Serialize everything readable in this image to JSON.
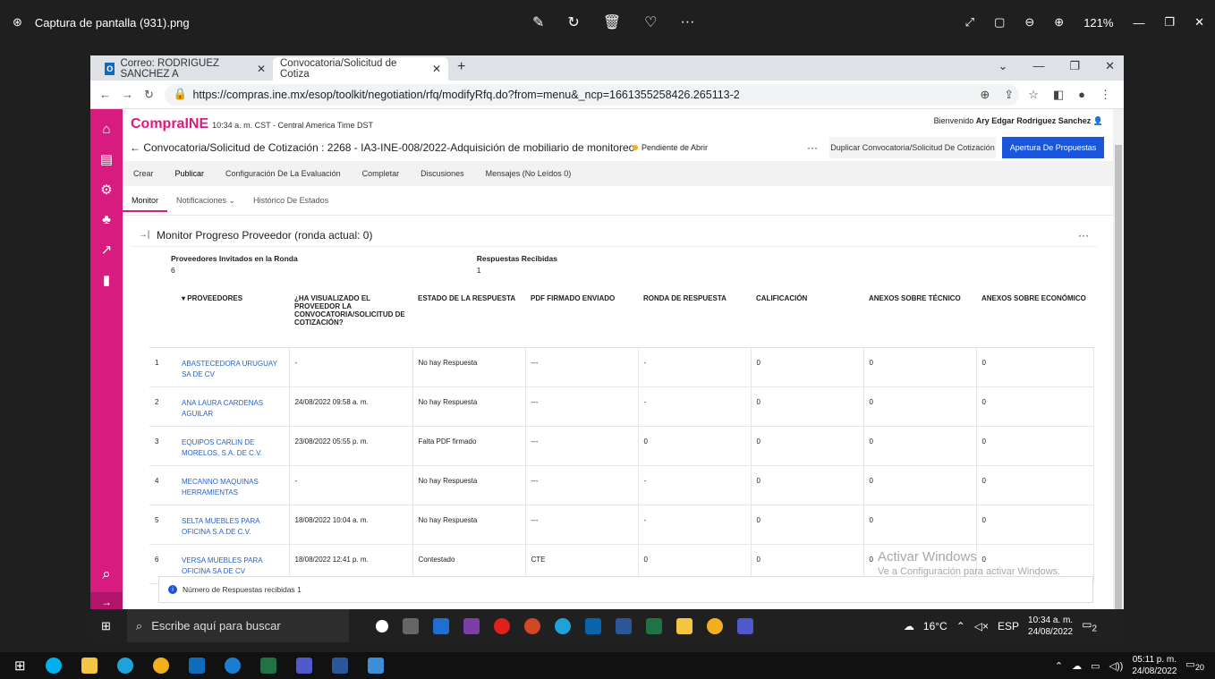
{
  "viewer": {
    "file": "Captura de pantalla (931).png",
    "zoom": "121%"
  },
  "browser": {
    "tabs": [
      {
        "label": "Correo: RODRIGUEZ SANCHEZ A"
      },
      {
        "label": "Convocatoria/Solicitud de Cotiza"
      }
    ],
    "url": "https://compras.ine.mx/esop/toolkit/negotiation/rfq/modifyRfq.do?from=menu&_ncp=1661355258426.265113-2"
  },
  "app": {
    "logo": "CompraINE",
    "time_zone": "10:34 a. m. CST - Central America Time DST",
    "welcome_prefix": "Bienvenido",
    "user": "Ary Edgar Rodriguez Sanchez",
    "page_title": "← Convocatoria/Solicitud de Cotización : 2268 - IA3-INE-008/2022-Adquisición de mobiliario de monitoreo",
    "status": "Pendiente de Abrir",
    "more": "···",
    "duplicate_label": "Duplicar Convocatoria/Solicitud De Cotización",
    "open_label": "Apertura De Propuestas",
    "menu": [
      "Crear",
      "Publicar",
      "Configuración De La Evaluación",
      "Completar",
      "Discusiones",
      "Mensajes (No Leídos 0)"
    ],
    "subtabs": [
      "Monitor",
      "Notificaciones ⌄",
      "Histórico De Estados"
    ],
    "panel_title": "Monitor Progreso Proveedor (ronda actual: 0)",
    "stats": [
      {
        "label": "Proveedores Invitados en la Ronda",
        "value": "6"
      },
      {
        "label": "Respuestas Recibidas",
        "value": "1"
      }
    ],
    "table": {
      "headers": [
        "",
        "▾ PROVEEDORES",
        "¿HA VISUALIZADO EL PROVEEDOR LA CONVOCATORIA/SOLICITUD DE COTIZACIÓN?",
        "ESTADO DE LA RESPUESTA",
        "PDF FIRMADO ENVIADO",
        "RONDA DE RESPUESTA",
        "CALIFICACIÓN",
        "ANEXOS SOBRE TÉCNICO",
        "ANEXOS SOBRE ECONÓMICO"
      ],
      "rows": [
        [
          "1",
          "ABASTECEDORA URUGUAY SA DE CV",
          "-",
          "No hay Respuesta",
          "---",
          "-",
          "0",
          "0",
          "0"
        ],
        [
          "2",
          "ANA LAURA CARDENAS AGUILAR",
          "24/08/2022 09:58 a. m.",
          "No hay Respuesta",
          "---",
          "-",
          "0",
          "0",
          "0"
        ],
        [
          "3",
          "EQUIPOS CARLIN DE MORELOS, S.A. DE C.V.",
          "23/08/2022 05:55 p. m.",
          "Falta PDF firmado",
          "---",
          "0",
          "0",
          "0",
          "0"
        ],
        [
          "4",
          "MECANNO MAQUINAS HERRAMIENTAS",
          "-",
          "No hay Respuesta",
          "---",
          "-",
          "0",
          "0",
          "0"
        ],
        [
          "5",
          "SELTA MUEBLES PARA OFICINA S.A.DE C.V.",
          "18/08/2022 10:04 a. m.",
          "No hay Respuesta",
          "---",
          "-",
          "0",
          "0",
          "0"
        ],
        [
          "6",
          "VERSA MUEBLES PARA OFICINA SA DE CV",
          "18/08/2022 12:41 p. m.",
          "Contestado",
          "CTE",
          "0",
          "0",
          "0",
          "0"
        ]
      ]
    },
    "footer_note": "Número de Respuestas recibidas 1"
  },
  "watermark": {
    "title": "Activar Windows",
    "subtitle": "Ve a Configuración para activar Windows."
  },
  "taskbar_inner": {
    "search_placeholder": "Escribe aquí para buscar",
    "weather": "16°C",
    "lang": "ESP",
    "time": "10:34 a. m.",
    "date": "24/08/2022",
    "notif": "2"
  },
  "taskbar_outer": {
    "time": "05:11 p. m.",
    "date": "24/08/2022",
    "notif": "20"
  },
  "colors": {
    "brand": "#d81b7f",
    "primary": "#1a56db",
    "link": "#2a62c9"
  }
}
